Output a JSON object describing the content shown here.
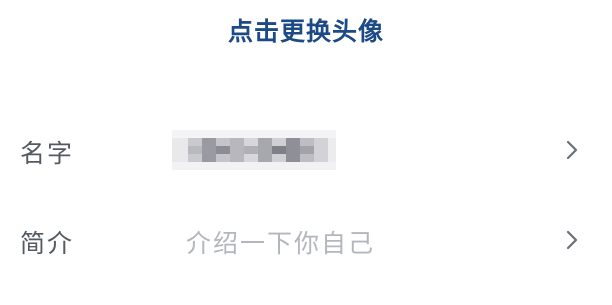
{
  "header": {
    "change_avatar_label": "点击更换头像",
    "accent_color": "#1c4a86"
  },
  "rows": [
    {
      "label": "名字",
      "value": "",
      "value_obscured": true,
      "chevron_icon": "chevron-right-icon"
    },
    {
      "label": "简介",
      "value_placeholder": "介绍一下你自己",
      "chevron_icon": "chevron-right-icon"
    }
  ]
}
